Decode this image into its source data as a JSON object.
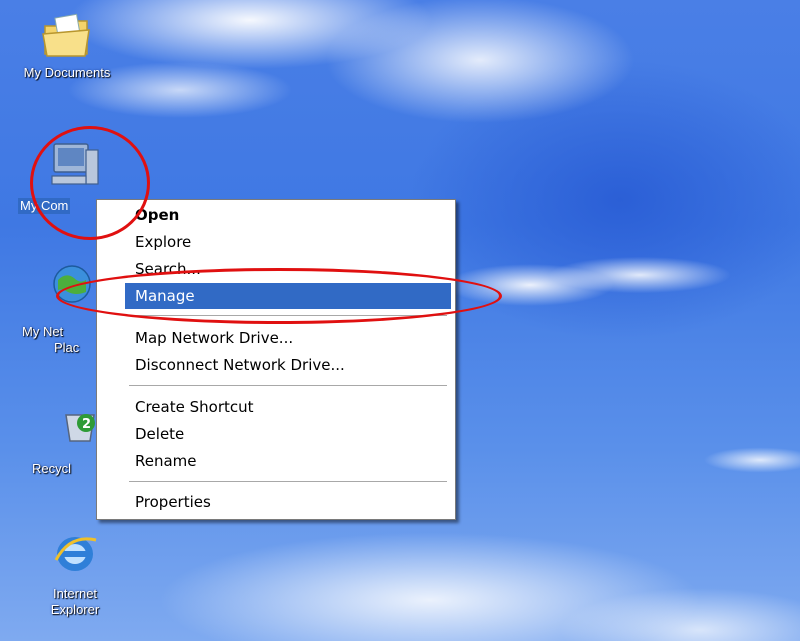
{
  "desktop": {
    "icons": [
      {
        "label": "My Documents",
        "icon": "folder-documents-icon"
      },
      {
        "label": "My Com",
        "icon": "my-computer-icon",
        "selected": true
      },
      {
        "label_line1": "My Net",
        "label_line2": "Plac",
        "icon": "network-places-icon"
      },
      {
        "label": "Recycl",
        "icon": "recycle-bin-icon"
      },
      {
        "label_line1": "Internet",
        "label_line2": "Explorer",
        "icon": "internet-explorer-icon"
      }
    ]
  },
  "context_menu": {
    "items": [
      {
        "label": "Open",
        "bold": true
      },
      {
        "label": "Explore"
      },
      {
        "label": "Search..."
      },
      {
        "label": "Manage",
        "highlighted": true
      },
      {
        "label": "Map Network Drive..."
      },
      {
        "label": "Disconnect Network Drive..."
      },
      {
        "label": "Create Shortcut"
      },
      {
        "label": "Delete"
      },
      {
        "label": "Rename"
      },
      {
        "label": "Properties"
      }
    ]
  },
  "colors": {
    "selection": "#316ac5",
    "annotation": "#e01010",
    "desktop_sky": "#3f78e3"
  }
}
